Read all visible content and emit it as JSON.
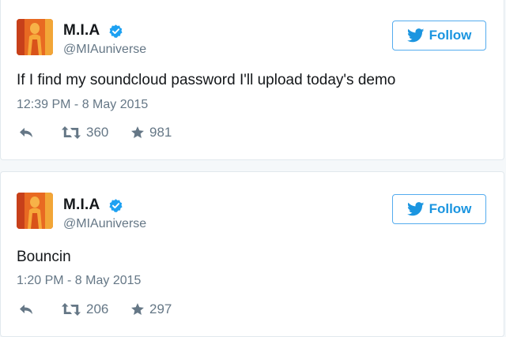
{
  "tweets": [
    {
      "display_name": "M.I.A",
      "handle": "@MIAuniverse",
      "follow_label": "Follow",
      "text": "If I find my soundcloud password I'll upload today's demo",
      "timestamp": "12:39 PM - 8 May 2015",
      "retweets": "360",
      "favorites": "981"
    },
    {
      "display_name": "M.I.A",
      "handle": "@MIAuniverse",
      "follow_label": "Follow",
      "text": "Bouncin",
      "timestamp": "1:20 PM - 8 May 2015",
      "retweets": "206",
      "favorites": "297"
    }
  ],
  "icons": {
    "verified": "verified-badge-icon",
    "follow": "twitter-bird-icon",
    "reply": "reply-icon",
    "retweet": "retweet-icon",
    "favorite": "star-icon"
  },
  "colors": {
    "accent": "#1b95e0",
    "follow_border": "#55acee",
    "muted": "#657786",
    "text": "#14171a",
    "border": "#e1e8ed",
    "background": "#f5f8fa"
  }
}
